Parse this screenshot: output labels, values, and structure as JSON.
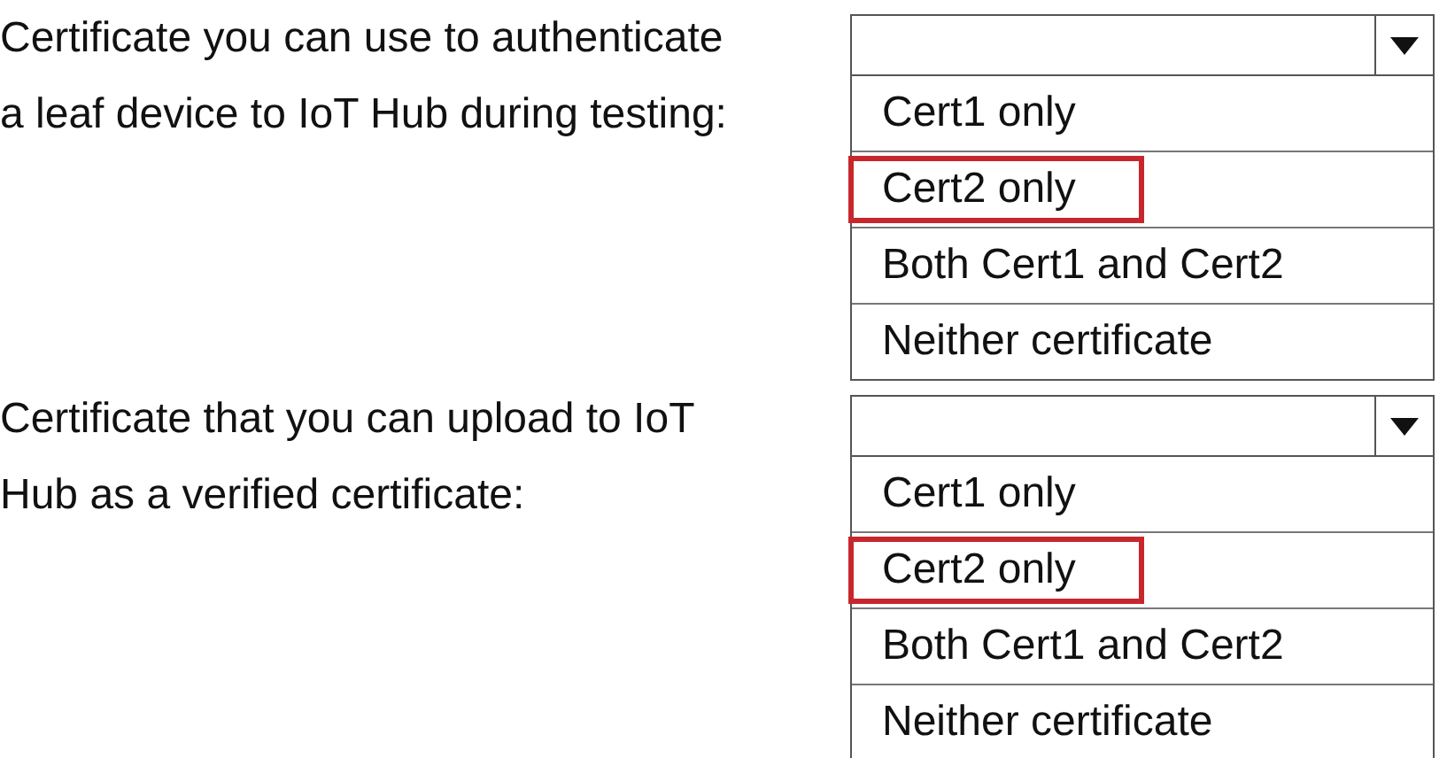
{
  "questions": [
    {
      "prompt_lines": [
        "Certificate you can use to authenticate",
        "a leaf device to IoT Hub during testing:"
      ],
      "options": [
        {
          "label": "Cert1 only",
          "selected": false
        },
        {
          "label": "Cert2 only",
          "selected": true
        },
        {
          "label": "Both Cert1 and Cert2",
          "selected": false
        },
        {
          "label": "Neither certificate",
          "selected": false
        }
      ]
    },
    {
      "prompt_lines": [
        "Certificate that you can upload to IoT",
        "Hub as a verified certificate:"
      ],
      "options": [
        {
          "label": "Cert1 only",
          "selected": false
        },
        {
          "label": "Cert2 only",
          "selected": true
        },
        {
          "label": "Both Cert1 and Cert2",
          "selected": false
        },
        {
          "label": "Neither certificate",
          "selected": false
        }
      ]
    }
  ]
}
